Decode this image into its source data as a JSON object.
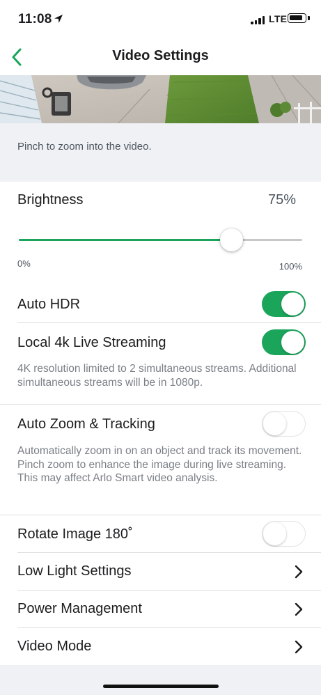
{
  "status_bar": {
    "time": "11:08",
    "network": "LTE",
    "icons": [
      "location-arrow-icon",
      "cellular-signal-icon",
      "battery-icon"
    ]
  },
  "nav": {
    "title": "Video Settings",
    "back_icon": "chevron-left-icon"
  },
  "video": {
    "hint": "Pinch to zoom into the video."
  },
  "brightness": {
    "label": "Brightness",
    "value": "75%",
    "level": 0.75,
    "min_label": "0%",
    "max_label": "100%"
  },
  "settings": {
    "auto_hdr": {
      "label": "Auto HDR",
      "on": true
    },
    "local_4k": {
      "label": "Local 4k Live Streaming",
      "on": true,
      "description": "4K resolution limited to 2 simultaneous streams. Additional simultaneous streams will be in 1080p."
    },
    "auto_zoom": {
      "label": "Auto Zoom & Tracking",
      "on": false,
      "description": "Automatically zoom in on an object and track its movement. Pinch zoom to enhance the image during live streaming. This may affect Arlo Smart video analysis."
    },
    "rotate": {
      "label": "Rotate Image 180˚",
      "on": false
    },
    "low_light": {
      "label": "Low Light Settings"
    },
    "power": {
      "label": "Power Management"
    },
    "video_mode": {
      "label": "Video Mode"
    }
  },
  "colors": {
    "accent": "#1aa55b",
    "section_bg": "#eff1f4",
    "secondary_text": "#7a7f86",
    "divider": "#dedede"
  }
}
